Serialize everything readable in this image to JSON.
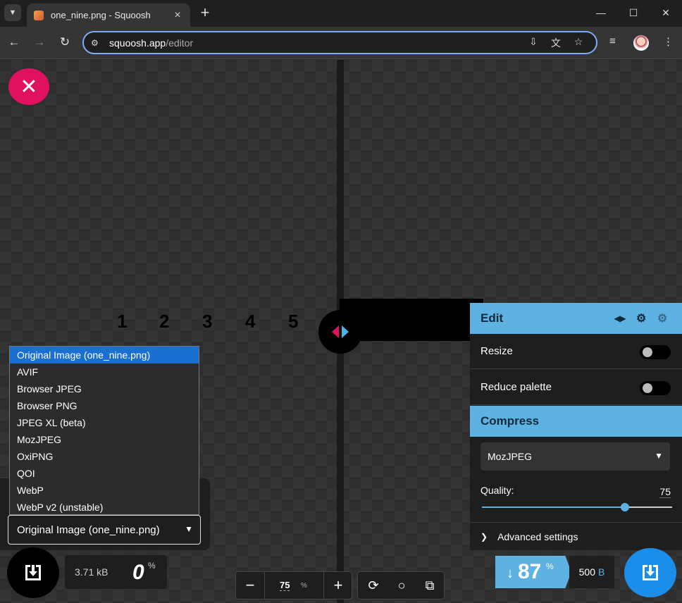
{
  "browser": {
    "tab_title": "one_nine.png - Squoosh",
    "url_host": "squoosh.app",
    "url_path": "/editor"
  },
  "canvas": {
    "digits": [
      "1",
      "2",
      "3",
      "4",
      "5"
    ]
  },
  "left": {
    "options": [
      "Original Image (one_nine.png)",
      "AVIF",
      "Browser JPEG",
      "Browser PNG",
      "JPEG XL (beta)",
      "MozJPEG",
      "OxiPNG",
      "QOI",
      "WebP",
      "WebP v2 (unstable)"
    ],
    "selected": "Original Image (one_nine.png)",
    "size": "3.71 kB",
    "percent": "0",
    "percent_sign": "%"
  },
  "zoom": {
    "value": "75",
    "unit": "%"
  },
  "edit_panel": {
    "title": "Edit",
    "resize_label": "Resize",
    "resize_on": false,
    "palette_label": "Reduce palette",
    "palette_on": false
  },
  "compress_panel": {
    "title": "Compress",
    "codec": "MozJPEG",
    "quality_label": "Quality:",
    "quality": "75",
    "quality_fraction": 0.75,
    "advanced_label": "Advanced settings"
  },
  "result": {
    "arrow": "↓",
    "percent": "87",
    "percent_sign": "%",
    "size": "500",
    "unit": "B"
  },
  "colors": {
    "accent_blue": "#5eb2e2",
    "accent_pink": "#e0115f"
  }
}
